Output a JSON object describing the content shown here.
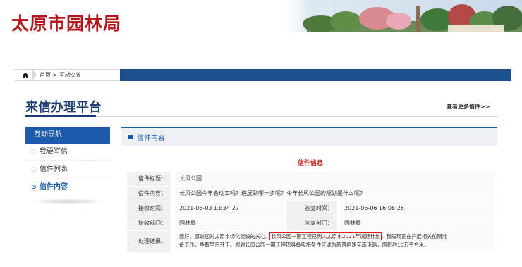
{
  "header": {
    "site_title": "太原市园林局"
  },
  "breadcrumb": {
    "home_label": "首页",
    "sep1": ">",
    "mid_label": "互动交流",
    "sep2": ">",
    "current": "信件内容"
  },
  "platform": {
    "title": "来信办理平台",
    "more_link": "查看更多信件>>"
  },
  "sidebar": {
    "header": "互动导航",
    "items": [
      {
        "label": "我要写信",
        "bullet": "○"
      },
      {
        "label": "信件列表",
        "bullet": "○"
      },
      {
        "label": "信件内容",
        "bullet": "⊙"
      }
    ]
  },
  "content": {
    "header": "信件内容",
    "section_title": "信件信息",
    "fields": {
      "subject_label": "信件标题：",
      "subject_value": "长风公园",
      "content_label": "信件内容：",
      "content_value": "长风公园今年会动工吗？进展到哪一步呢？今年长风公园的规划是什么呢？",
      "recv_time_label": "接收时间：",
      "recv_time_value": "2021-05-03 13:34:27",
      "reply_time_label": "答复时间：",
      "reply_time_value": "2021-05-06 16:06:26",
      "recv_dept_label": "接收部门：",
      "recv_dept_value": "园林局",
      "reply_dept_label": "答复部门：",
      "reply_dept_value": "园林局",
      "result_label": "处理结果：",
      "result_part1": "您好，感谢您对太原市绿化建设的关心。",
      "result_highlight": "长风公园一期工程已列入太原市2021年城建计划",
      "result_part2": "，我局现正在开展相关前期准",
      "result_line2": "备工作，争取早日开工。规划长风公园一期工程现具备实施条件区域为新晋祠路至南屯路，面积约10万平方米。"
    }
  },
  "colors": {
    "brand_red": "#b5161b",
    "nav_blue": "#1c5bab",
    "title_blue": "#1f3e73",
    "highlight_red": "#e11b1b"
  }
}
